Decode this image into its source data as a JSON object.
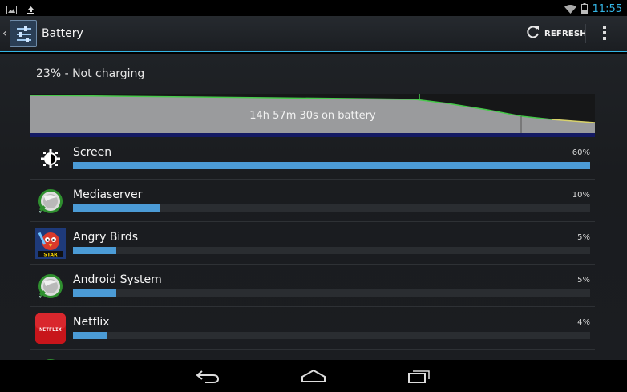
{
  "status_bar": {
    "time": "11:55",
    "icons": [
      "image-notification-icon",
      "upload-icon",
      "wifi-icon",
      "battery-icon"
    ]
  },
  "action_bar": {
    "title": "Battery",
    "refresh_label": "REFRESH",
    "icons": [
      "back-caret-icon",
      "settings-app-icon",
      "refresh-icon",
      "overflow-menu-icon"
    ]
  },
  "summary": "23% - Not charging",
  "battery_graph": {
    "label": "14h 57m 30s on battery",
    "line_color": "#46c94a",
    "low_line_color": "#d9d36a"
  },
  "usage": [
    {
      "name": "Screen",
      "percent": "60%",
      "fraction": 0.6,
      "icon": "screen-brightness-icon"
    },
    {
      "name": "Mediaserver",
      "percent": "10%",
      "fraction": 0.1,
      "icon": "android-system-icon"
    },
    {
      "name": "Angry Birds",
      "percent": "5%",
      "fraction": 0.05,
      "icon": "angry-birds-star-wars-icon"
    },
    {
      "name": "Android System",
      "percent": "5%",
      "fraction": 0.05,
      "icon": "android-system-icon"
    },
    {
      "name": "Netflix",
      "percent": "4%",
      "fraction": 0.04,
      "icon": "netflix-icon",
      "icon_text": "NETFLIX"
    }
  ],
  "nav_bar": {
    "icons": [
      "back-icon",
      "home-icon",
      "recent-apps-icon"
    ]
  },
  "colors": {
    "accent": "#33b5e5",
    "bar_fill": "#4b9bd6"
  }
}
